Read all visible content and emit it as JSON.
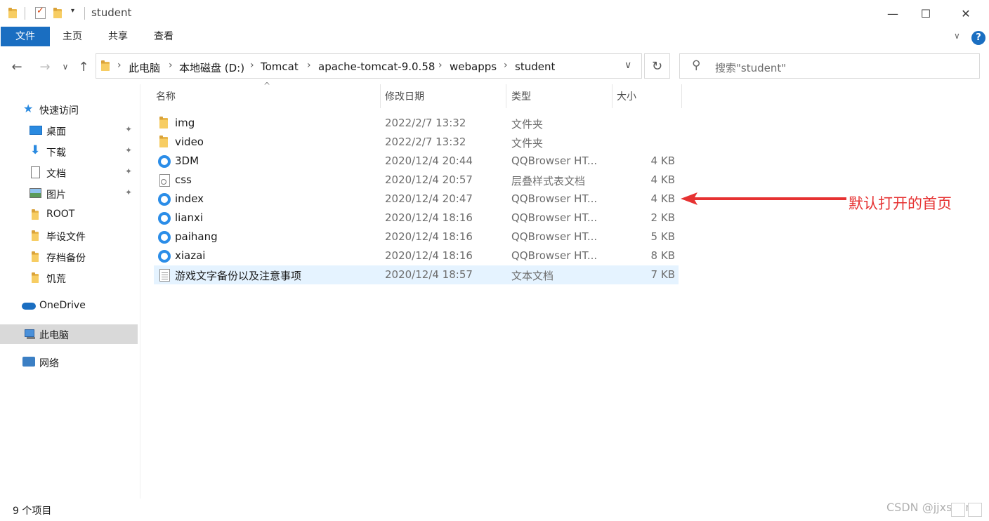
{
  "window": {
    "title": "student",
    "minimize_glyph": "—",
    "maximize_glyph": "☐",
    "close_glyph": "✕"
  },
  "ribbon": {
    "tabs": [
      "文件",
      "主页",
      "共享",
      "查看"
    ],
    "help_glyph": "?",
    "collapse_glyph": "∨"
  },
  "address": {
    "crumbs": [
      "此电脑",
      "本地磁盘 (D:)",
      "Tomcat",
      "apache-tomcat-9.0.58",
      "webapps",
      "student"
    ],
    "separator": "›",
    "dropdown_glyph": "∨",
    "refresh_glyph": "↻",
    "back_glyph": "←",
    "forward_glyph": "→",
    "recent_glyph": "∨",
    "up_glyph": "↑"
  },
  "search": {
    "placeholder": "搜索\"student\"",
    "icon_glyph": "⚲"
  },
  "nav": {
    "quick_access": "快速访问",
    "items": [
      {
        "label": "桌面",
        "pinned": true
      },
      {
        "label": "下载",
        "pinned": true
      },
      {
        "label": "文档",
        "pinned": true
      },
      {
        "label": "图片",
        "pinned": true
      },
      {
        "label": "ROOT",
        "pinned": false
      },
      {
        "label": "毕设文件",
        "pinned": false
      },
      {
        "label": "存档备份",
        "pinned": false
      },
      {
        "label": "饥荒",
        "pinned": false
      }
    ],
    "onedrive": "OneDrive",
    "this_pc": "此电脑",
    "network": "网络",
    "pin_glyph": "📌"
  },
  "columns": {
    "name": "名称",
    "date": "修改日期",
    "type": "类型",
    "size": "大小",
    "sort_glyph": "^"
  },
  "files": [
    {
      "name": "img",
      "date": "2022/2/7 13:32",
      "type": "文件夹",
      "size": "",
      "icon": "folder-icon"
    },
    {
      "name": "video",
      "date": "2022/2/7 13:32",
      "type": "文件夹",
      "size": "",
      "icon": "folder-icon"
    },
    {
      "name": "3DM",
      "date": "2020/12/4 20:44",
      "type": "QQBrowser HT...",
      "size": "4 KB",
      "icon": "html-file-icon"
    },
    {
      "name": "css",
      "date": "2020/12/4 20:57",
      "type": "层叠样式表文档",
      "size": "4 KB",
      "icon": "css-file-icon"
    },
    {
      "name": "index",
      "date": "2020/12/4 20:47",
      "type": "QQBrowser HT...",
      "size": "4 KB",
      "icon": "html-file-icon"
    },
    {
      "name": "lianxi",
      "date": "2020/12/4 18:16",
      "type": "QQBrowser HT...",
      "size": "2 KB",
      "icon": "html-file-icon"
    },
    {
      "name": "paihang",
      "date": "2020/12/4 18:16",
      "type": "QQBrowser HT...",
      "size": "5 KB",
      "icon": "html-file-icon"
    },
    {
      "name": "xiazai",
      "date": "2020/12/4 18:16",
      "type": "QQBrowser HT...",
      "size": "8 KB",
      "icon": "html-file-icon"
    },
    {
      "name": "游戏文字备份以及注意事项",
      "date": "2020/12/4 18:57",
      "type": "文本文档",
      "size": "7 KB",
      "icon": "text-file-icon"
    }
  ],
  "selected_file_index": 8,
  "annotation": {
    "text": "默认打开的首页",
    "color": "#e63232"
  },
  "status": {
    "item_count": "9 个项目"
  },
  "watermark": "CSDN @jjxscdn",
  "colors": {
    "accent": "#1a6ec1",
    "folder": "#f7cd63",
    "selection": "#e5f3ff"
  }
}
